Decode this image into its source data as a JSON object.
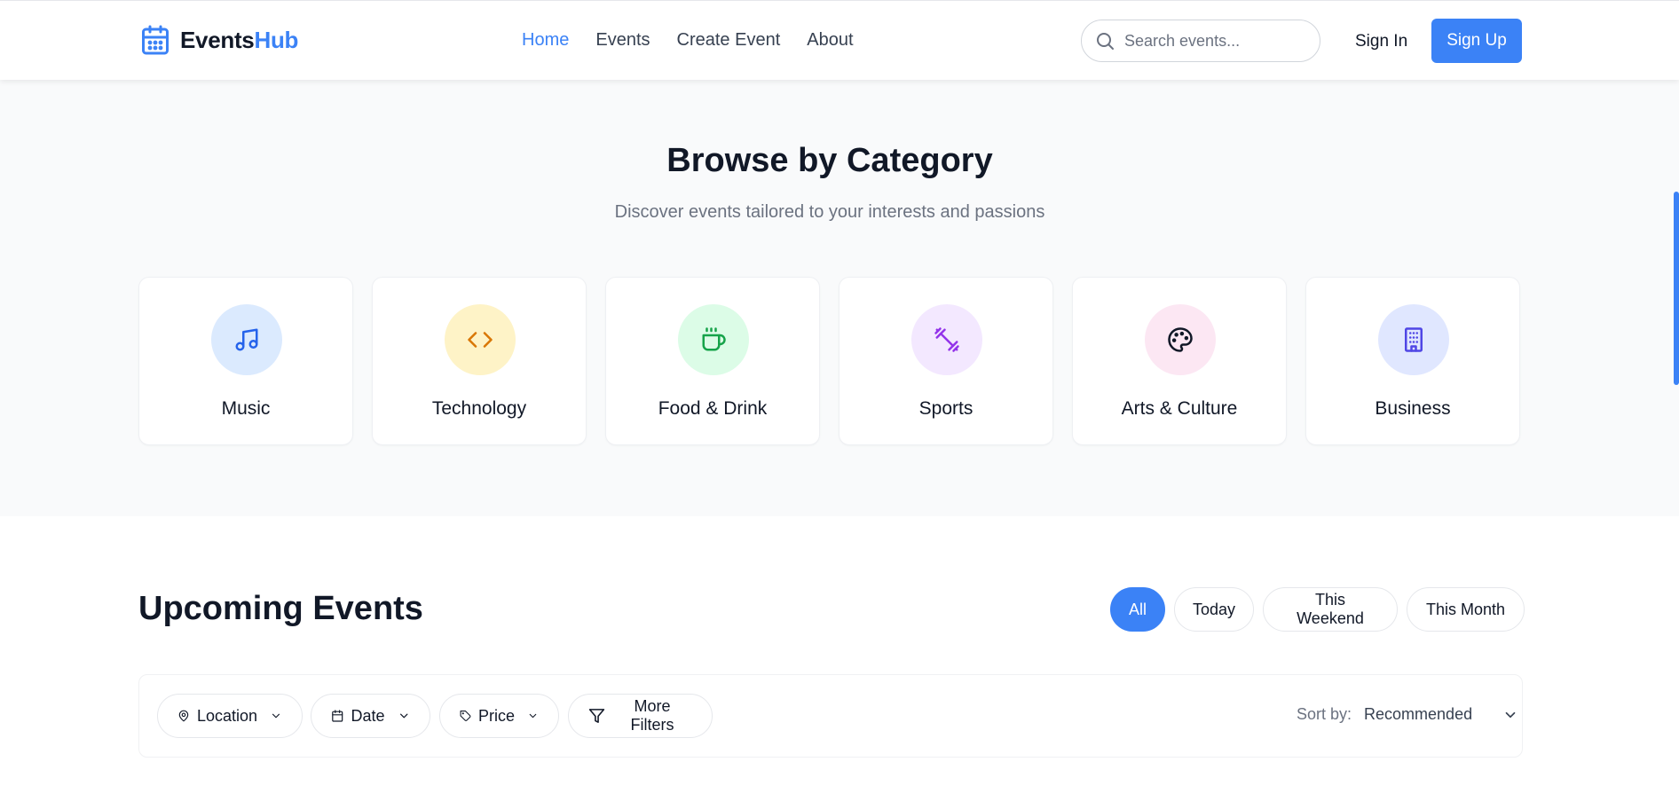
{
  "header": {
    "logo_part1": "Events",
    "logo_part2": "Hub",
    "nav": [
      {
        "label": "Home",
        "active": true
      },
      {
        "label": "Events",
        "active": false
      },
      {
        "label": "Create Event",
        "active": false
      },
      {
        "label": "About",
        "active": false
      }
    ],
    "search_placeholder": "Search events...",
    "sign_in": "Sign In",
    "sign_up": "Sign Up"
  },
  "categories": {
    "title": "Browse by Category",
    "subtitle": "Discover events tailored to your interests and passions",
    "items": [
      {
        "label": "Music",
        "icon": "music-icon",
        "bg": "#dbeafe",
        "color": "#2563eb"
      },
      {
        "label": "Technology",
        "icon": "code-icon",
        "bg": "#fef3c7",
        "color": "#d97706"
      },
      {
        "label": "Food & Drink",
        "icon": "coffee-icon",
        "bg": "#dcfce7",
        "color": "#16a34a"
      },
      {
        "label": "Sports",
        "icon": "dumbbell-icon",
        "bg": "#f3e8ff",
        "color": "#9333ea"
      },
      {
        "label": "Arts & Culture",
        "icon": "palette-icon",
        "bg": "#fce7f3",
        "color": "#111827"
      },
      {
        "label": "Business",
        "icon": "building-icon",
        "bg": "#e0e7ff",
        "color": "#4f46e5"
      }
    ]
  },
  "upcoming": {
    "title": "Upcoming Events",
    "time_filters": [
      {
        "label": "All",
        "active": true
      },
      {
        "label": "Today",
        "active": false
      },
      {
        "label": "This Weekend",
        "active": false
      },
      {
        "label": "This Month",
        "active": false
      }
    ],
    "filters": [
      {
        "label": "Location",
        "icon": "map-pin-icon",
        "chevron": true
      },
      {
        "label": "Date",
        "icon": "calendar-icon",
        "chevron": true
      },
      {
        "label": "Price",
        "icon": "tag-icon",
        "chevron": true
      },
      {
        "label": "More Filters",
        "icon": "filter-icon",
        "chevron": false
      }
    ],
    "sort_label": "Sort by:",
    "sort_value": "Recommended"
  },
  "colors": {
    "accent": "#3b82f6"
  }
}
